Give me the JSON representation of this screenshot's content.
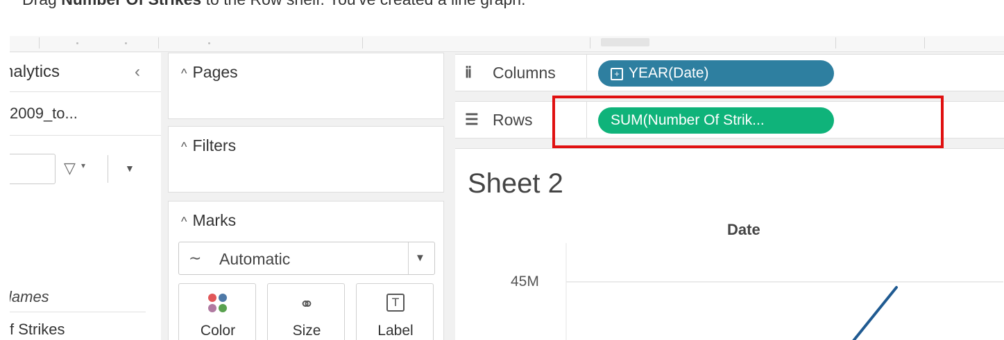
{
  "instruction": {
    "prefix": "Drag ",
    "bold": "Number Of Strikes",
    "suffix": " to the Row shelf. You've created a line graph."
  },
  "data_pane": {
    "title": "nalytics",
    "collapse_icon": "chevron-left-icon",
    "datasource": "2009_to...",
    "section_label": "lames",
    "field": "f Strikes"
  },
  "cards": {
    "pages": "Pages",
    "filters": "Filters",
    "marks": {
      "title": "Marks",
      "type": "Automatic",
      "color_label": "Color",
      "size_label": "Size",
      "label_label": "Label",
      "label_glyph": "T",
      "dot_colors": [
        "#e15759",
        "#4e79a7",
        "#b07aa1",
        "#59a14f"
      ]
    }
  },
  "shelves": {
    "columns": {
      "label": "Columns",
      "pill": "YEAR(Date)",
      "pill_color": "#2e7fa0"
    },
    "rows": {
      "label": "Rows",
      "pill": "SUM(Number Of Strik...",
      "pill_color": "#0fb37a"
    }
  },
  "worksheet": {
    "sheet_title": "Sheet 2",
    "column_header": "Date"
  },
  "chart_data": {
    "type": "line",
    "x": [],
    "series": [],
    "title": "",
    "xlabel": "Date",
    "ylabel": "",
    "y_tick_labels": [
      "45M"
    ],
    "line_color": "#1f5a91",
    "grid": true
  },
  "highlight_color": "#e01010"
}
